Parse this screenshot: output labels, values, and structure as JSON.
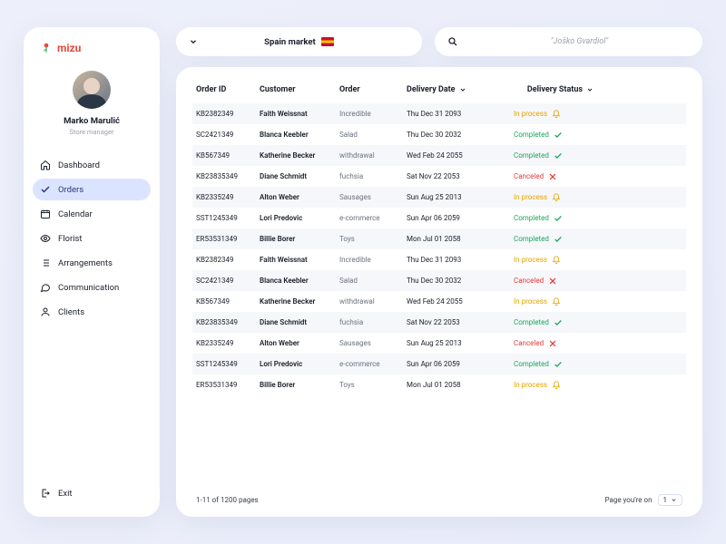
{
  "brand": {
    "name": "mizu"
  },
  "user": {
    "name": "Marko Marulić",
    "role": "Store manager"
  },
  "nav": {
    "items": [
      {
        "label": "Dashboard",
        "icon": "home-icon"
      },
      {
        "label": "Orders",
        "icon": "check-icon",
        "active": true
      },
      {
        "label": "Calendar",
        "icon": "calendar-icon"
      },
      {
        "label": "Florist",
        "icon": "eye-icon"
      },
      {
        "label": "Arrangements",
        "icon": "list-icon"
      },
      {
        "label": "Communication",
        "icon": "chat-icon"
      },
      {
        "label": "Clients",
        "icon": "person-icon"
      }
    ],
    "exit": "Exit"
  },
  "market": {
    "label": "Spain market",
    "flag": "spain-flag"
  },
  "search": {
    "placeholder": "\"Joško Gvardiol\""
  },
  "table": {
    "columns": {
      "order_id": "Order ID",
      "customer": "Customer",
      "order": "Order",
      "delivery_date": "Delivery Date",
      "delivery_status": "Delivery Status"
    },
    "statuses": {
      "inprocess": "In process",
      "completed": "Completed",
      "canceled": "Canceled"
    },
    "rows": [
      {
        "id": "KB2382349",
        "customer": "Faith Weissnat",
        "order": "Incredible",
        "date": "Thu Dec 31 2093",
        "status": "inprocess"
      },
      {
        "id": "SC2421349",
        "customer": "Blanca Keebler",
        "order": "Salad",
        "date": "Thu Dec 30 2032",
        "status": "completed"
      },
      {
        "id": "KB567349",
        "customer": "Katherine Becker",
        "order": "withdrawal",
        "date": "Wed Feb 24 2055",
        "status": "completed"
      },
      {
        "id": "KB23835349",
        "customer": "Diane Schmidt",
        "order": "fuchsia",
        "date": "Sat Nov 22 2053",
        "status": "canceled"
      },
      {
        "id": "KB2335249",
        "customer": "Alton Weber",
        "order": "Sausages",
        "date": "Sun Aug 25 2013",
        "status": "inprocess"
      },
      {
        "id": "SST1245349",
        "customer": "Lori Predovic",
        "order": "e-commerce",
        "date": "Sun Apr 06 2059",
        "status": "completed"
      },
      {
        "id": "ER53531349",
        "customer": "Billie Borer",
        "order": "Toys",
        "date": "Mon Jul 01 2058",
        "status": "completed"
      },
      {
        "id": "KB2382349",
        "customer": "Faith Weissnat",
        "order": "Incredible",
        "date": "Thu Dec 31 2093",
        "status": "inprocess"
      },
      {
        "id": "SC2421349",
        "customer": "Blanca Keebler",
        "order": "Salad",
        "date": "Thu Dec 30 2032",
        "status": "canceled"
      },
      {
        "id": "KB567349",
        "customer": "Katherine Becker",
        "order": "withdrawal",
        "date": "Wed Feb 24 2055",
        "status": "inprocess"
      },
      {
        "id": "KB23835349",
        "customer": "Diane Schmidt",
        "order": "fuchsia",
        "date": "Sat Nov 22 2053",
        "status": "completed"
      },
      {
        "id": "KB2335249",
        "customer": "Alton Weber",
        "order": "Sausages",
        "date": "Sun Aug 25 2013",
        "status": "canceled"
      },
      {
        "id": "SST1245349",
        "customer": "Lori Predovic",
        "order": "e-commerce",
        "date": "Sun Apr 06 2059",
        "status": "completed"
      },
      {
        "id": "ER53531349",
        "customer": "Billie Borer",
        "order": "Toys",
        "date": "Mon Jul 01 2058",
        "status": "inprocess"
      }
    ]
  },
  "pager": {
    "summary": "1-11 of 1200 pages",
    "label": "Page you're on",
    "current": "1"
  }
}
